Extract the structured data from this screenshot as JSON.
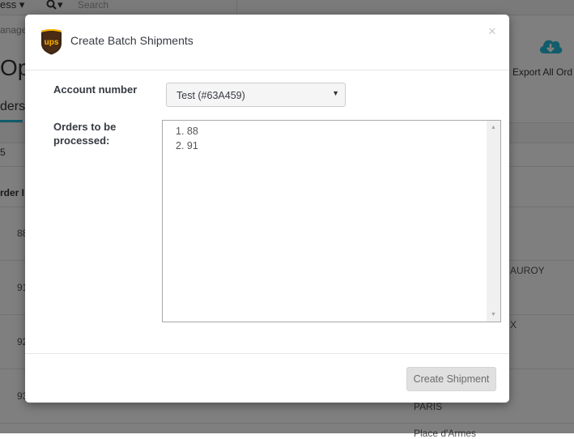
{
  "background": {
    "topbar": {
      "menu_text": "ess",
      "menu_caret": "▾",
      "search_icon": "search-icon",
      "search_caret": "▾",
      "search_placeholder": "Search"
    },
    "breadcrumb": "anage",
    "page_title": "Op",
    "export": {
      "icon": "cloud-download-icon",
      "label": "Export All Ord"
    },
    "tab_label": "ders",
    "count": "5",
    "column_header": "rder I",
    "rows": [
      {
        "id": "88",
        "right_text": ""
      },
      {
        "id": "91",
        "right_text": "AUROY"
      },
      {
        "id": "92",
        "right_text": "X"
      },
      {
        "id": "93",
        "right_text": "PARIS"
      },
      {
        "id": "",
        "right_text": "Place d'Armes"
      }
    ]
  },
  "modal": {
    "logo": "ups-logo",
    "title": "Create Batch Shipments",
    "close_label": "×",
    "account": {
      "label": "Account number",
      "selected": "Test (#63A459)"
    },
    "orders": {
      "label_line1": "Orders to be",
      "label_line2": "processed:",
      "items": [
        "1. 88",
        "2. 91"
      ]
    },
    "submit_label": "Create Shipment"
  }
}
